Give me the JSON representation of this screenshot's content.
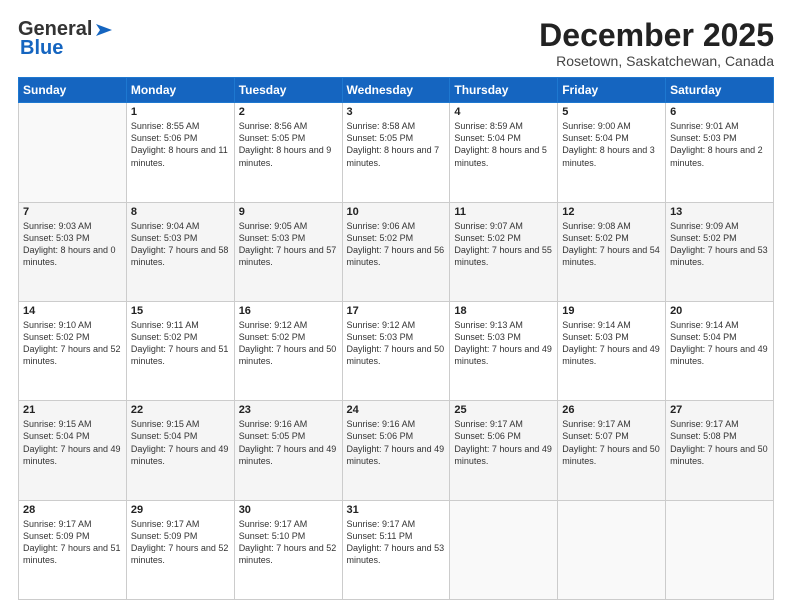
{
  "header": {
    "logo_line1": "General",
    "logo_line2": "Blue",
    "month": "December 2025",
    "location": "Rosetown, Saskatchewan, Canada"
  },
  "days_of_week": [
    "Sunday",
    "Monday",
    "Tuesday",
    "Wednesday",
    "Thursday",
    "Friday",
    "Saturday"
  ],
  "weeks": [
    [
      {
        "num": "",
        "sunrise": "",
        "sunset": "",
        "daylight": "",
        "empty": true
      },
      {
        "num": "1",
        "sunrise": "Sunrise: 8:55 AM",
        "sunset": "Sunset: 5:06 PM",
        "daylight": "Daylight: 8 hours and 11 minutes."
      },
      {
        "num": "2",
        "sunrise": "Sunrise: 8:56 AM",
        "sunset": "Sunset: 5:05 PM",
        "daylight": "Daylight: 8 hours and 9 minutes."
      },
      {
        "num": "3",
        "sunrise": "Sunrise: 8:58 AM",
        "sunset": "Sunset: 5:05 PM",
        "daylight": "Daylight: 8 hours and 7 minutes."
      },
      {
        "num": "4",
        "sunrise": "Sunrise: 8:59 AM",
        "sunset": "Sunset: 5:04 PM",
        "daylight": "Daylight: 8 hours and 5 minutes."
      },
      {
        "num": "5",
        "sunrise": "Sunrise: 9:00 AM",
        "sunset": "Sunset: 5:04 PM",
        "daylight": "Daylight: 8 hours and 3 minutes."
      },
      {
        "num": "6",
        "sunrise": "Sunrise: 9:01 AM",
        "sunset": "Sunset: 5:03 PM",
        "daylight": "Daylight: 8 hours and 2 minutes."
      }
    ],
    [
      {
        "num": "7",
        "sunrise": "Sunrise: 9:03 AM",
        "sunset": "Sunset: 5:03 PM",
        "daylight": "Daylight: 8 hours and 0 minutes."
      },
      {
        "num": "8",
        "sunrise": "Sunrise: 9:04 AM",
        "sunset": "Sunset: 5:03 PM",
        "daylight": "Daylight: 7 hours and 58 minutes."
      },
      {
        "num": "9",
        "sunrise": "Sunrise: 9:05 AM",
        "sunset": "Sunset: 5:03 PM",
        "daylight": "Daylight: 7 hours and 57 minutes."
      },
      {
        "num": "10",
        "sunrise": "Sunrise: 9:06 AM",
        "sunset": "Sunset: 5:02 PM",
        "daylight": "Daylight: 7 hours and 56 minutes."
      },
      {
        "num": "11",
        "sunrise": "Sunrise: 9:07 AM",
        "sunset": "Sunset: 5:02 PM",
        "daylight": "Daylight: 7 hours and 55 minutes."
      },
      {
        "num": "12",
        "sunrise": "Sunrise: 9:08 AM",
        "sunset": "Sunset: 5:02 PM",
        "daylight": "Daylight: 7 hours and 54 minutes."
      },
      {
        "num": "13",
        "sunrise": "Sunrise: 9:09 AM",
        "sunset": "Sunset: 5:02 PM",
        "daylight": "Daylight: 7 hours and 53 minutes."
      }
    ],
    [
      {
        "num": "14",
        "sunrise": "Sunrise: 9:10 AM",
        "sunset": "Sunset: 5:02 PM",
        "daylight": "Daylight: 7 hours and 52 minutes."
      },
      {
        "num": "15",
        "sunrise": "Sunrise: 9:11 AM",
        "sunset": "Sunset: 5:02 PM",
        "daylight": "Daylight: 7 hours and 51 minutes."
      },
      {
        "num": "16",
        "sunrise": "Sunrise: 9:12 AM",
        "sunset": "Sunset: 5:02 PM",
        "daylight": "Daylight: 7 hours and 50 minutes."
      },
      {
        "num": "17",
        "sunrise": "Sunrise: 9:12 AM",
        "sunset": "Sunset: 5:03 PM",
        "daylight": "Daylight: 7 hours and 50 minutes."
      },
      {
        "num": "18",
        "sunrise": "Sunrise: 9:13 AM",
        "sunset": "Sunset: 5:03 PM",
        "daylight": "Daylight: 7 hours and 49 minutes."
      },
      {
        "num": "19",
        "sunrise": "Sunrise: 9:14 AM",
        "sunset": "Sunset: 5:03 PM",
        "daylight": "Daylight: 7 hours and 49 minutes."
      },
      {
        "num": "20",
        "sunrise": "Sunrise: 9:14 AM",
        "sunset": "Sunset: 5:04 PM",
        "daylight": "Daylight: 7 hours and 49 minutes."
      }
    ],
    [
      {
        "num": "21",
        "sunrise": "Sunrise: 9:15 AM",
        "sunset": "Sunset: 5:04 PM",
        "daylight": "Daylight: 7 hours and 49 minutes."
      },
      {
        "num": "22",
        "sunrise": "Sunrise: 9:15 AM",
        "sunset": "Sunset: 5:04 PM",
        "daylight": "Daylight: 7 hours and 49 minutes."
      },
      {
        "num": "23",
        "sunrise": "Sunrise: 9:16 AM",
        "sunset": "Sunset: 5:05 PM",
        "daylight": "Daylight: 7 hours and 49 minutes."
      },
      {
        "num": "24",
        "sunrise": "Sunrise: 9:16 AM",
        "sunset": "Sunset: 5:06 PM",
        "daylight": "Daylight: 7 hours and 49 minutes."
      },
      {
        "num": "25",
        "sunrise": "Sunrise: 9:17 AM",
        "sunset": "Sunset: 5:06 PM",
        "daylight": "Daylight: 7 hours and 49 minutes."
      },
      {
        "num": "26",
        "sunrise": "Sunrise: 9:17 AM",
        "sunset": "Sunset: 5:07 PM",
        "daylight": "Daylight: 7 hours and 50 minutes."
      },
      {
        "num": "27",
        "sunrise": "Sunrise: 9:17 AM",
        "sunset": "Sunset: 5:08 PM",
        "daylight": "Daylight: 7 hours and 50 minutes."
      }
    ],
    [
      {
        "num": "28",
        "sunrise": "Sunrise: 9:17 AM",
        "sunset": "Sunset: 5:09 PM",
        "daylight": "Daylight: 7 hours and 51 minutes."
      },
      {
        "num": "29",
        "sunrise": "Sunrise: 9:17 AM",
        "sunset": "Sunset: 5:09 PM",
        "daylight": "Daylight: 7 hours and 52 minutes."
      },
      {
        "num": "30",
        "sunrise": "Sunrise: 9:17 AM",
        "sunset": "Sunset: 5:10 PM",
        "daylight": "Daylight: 7 hours and 52 minutes."
      },
      {
        "num": "31",
        "sunrise": "Sunrise: 9:17 AM",
        "sunset": "Sunset: 5:11 PM",
        "daylight": "Daylight: 7 hours and 53 minutes."
      },
      {
        "num": "",
        "sunrise": "",
        "sunset": "",
        "daylight": "",
        "empty": true
      },
      {
        "num": "",
        "sunrise": "",
        "sunset": "",
        "daylight": "",
        "empty": true
      },
      {
        "num": "",
        "sunrise": "",
        "sunset": "",
        "daylight": "",
        "empty": true
      }
    ]
  ]
}
